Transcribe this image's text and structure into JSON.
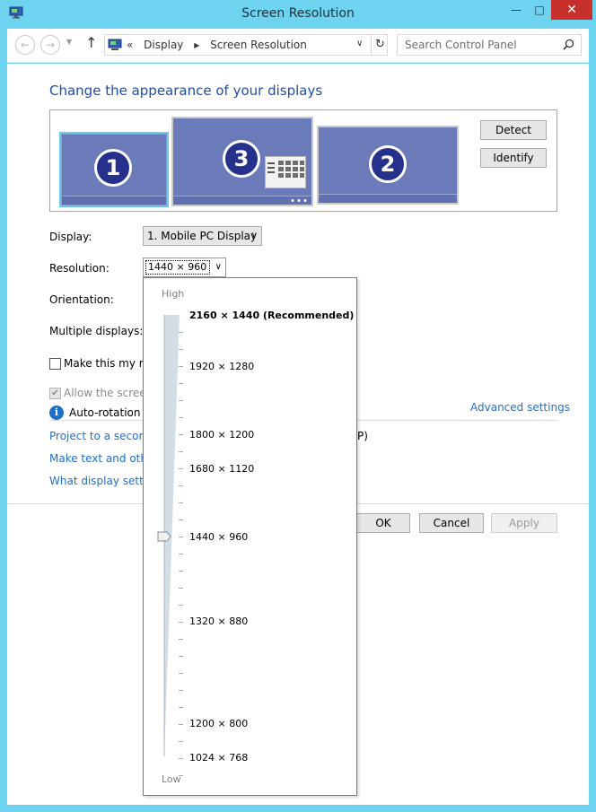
{
  "window": {
    "title": "Screen Resolution",
    "minimize_glyph": "—",
    "maximize_glyph": "□",
    "close_glyph": "✕"
  },
  "navigation": {
    "back_glyph": "←",
    "forward_glyph": "→",
    "up_glyph": "↑",
    "breadcrumb_prefix": "«",
    "breadcrumbs": [
      "Display",
      "Screen Resolution"
    ],
    "separator": "▸",
    "refresh_glyph": "↻",
    "search_placeholder": "Search Control Panel"
  },
  "main": {
    "heading": "Change the appearance of your displays",
    "monitors": [
      {
        "number": "1",
        "selected": true
      },
      {
        "number": "3",
        "selected": false
      },
      {
        "number": "2",
        "selected": false
      }
    ],
    "detect_label": "Detect",
    "identify_label": "Identify",
    "display_label": "Display:",
    "display_value": "1. Mobile PC Display",
    "resolution_label": "Resolution:",
    "resolution_value": "1440 × 960",
    "orientation_label": "Orientation:",
    "multiple_label": "Multiple displays:",
    "main_display_label": "Make this my ma",
    "allow_rotation_label": "Allow the screen",
    "autorotation_text": "Auto-rotation is",
    "advanced_link": "Advanced settings",
    "link_project": "Project to a second",
    "link_project_tail": "P)",
    "link_text_size": "Make text and other",
    "link_what_settings": "What display setting",
    "ok_label": "OK",
    "cancel_label": "Cancel",
    "apply_label": "Apply"
  },
  "resolution_popup": {
    "high_label": "High",
    "low_label": "Low",
    "options": [
      {
        "label": "2160 × 1440 (Recommended)",
        "bold": true
      },
      {
        "label": "1920 × 1280",
        "bold": false
      },
      {
        "label": "1800 × 1200",
        "bold": false
      },
      {
        "label": "1680 × 1120",
        "bold": false
      },
      {
        "label": "1440 × 960",
        "bold": false
      },
      {
        "label": "1320 × 880",
        "bold": false
      },
      {
        "label": "1200 × 800",
        "bold": false
      },
      {
        "label": "1024 × 768",
        "bold": false
      }
    ],
    "selected": "1440 × 960"
  },
  "colors": {
    "frame": "#6dd3ef",
    "link": "#1f6fc7",
    "heading": "#1f4ea5",
    "monitor_fill": "#6b7ab8",
    "monitor_badge": "#26318b",
    "close": "#c7302b"
  }
}
